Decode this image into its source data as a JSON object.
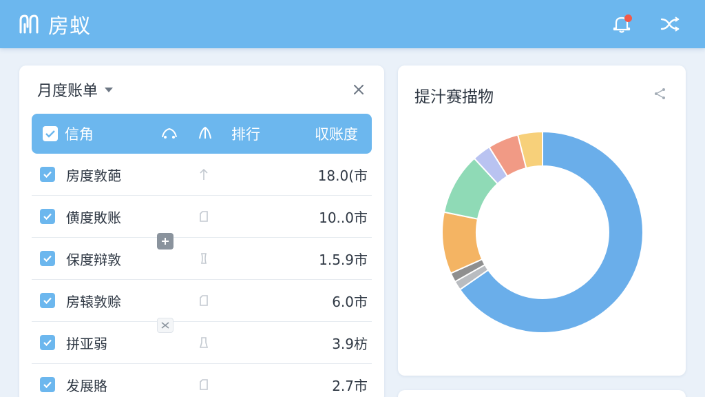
{
  "app": {
    "title": "房蚁"
  },
  "topbar": {
    "bell_icon": "bell-icon",
    "close_icon": "shuffle-close-icon",
    "notification_dot_color": "#f15a4a"
  },
  "bill_panel": {
    "title": "月度账单",
    "header": {
      "name": "信角",
      "sort": "排行",
      "amount": "収账度"
    },
    "rows": [
      {
        "name": "房度敦葩",
        "icon": "arrow-up-icon",
        "amount": "18.0(市"
      },
      {
        "name": "僙度敗账",
        "icon": "tag-icon",
        "amount": "10..0市"
      },
      {
        "name": "保度辩敦",
        "icon": "tag-icon",
        "amount": "1.5.9市"
      },
      {
        "name": "房辕敦赊",
        "icon": "tag-icon",
        "amount": "6.0市"
      },
      {
        "name": "拼亚弱",
        "icon": "tag-icon",
        "amount": "3.9枋"
      },
      {
        "name": "发展賂",
        "icon": "tag-icon",
        "amount": "2.7市"
      }
    ]
  },
  "chart_panel": {
    "title": "提汁赛描物"
  },
  "chart_data": {
    "type": "pie",
    "donut": true,
    "values": [
      66,
      1.5,
      1.5,
      10,
      10,
      3,
      5,
      4
    ],
    "colors": [
      "#6aaeea",
      "#b9bcc0",
      "#8f8f8f",
      "#f4b463",
      "#8fdab6",
      "#b9c3f1",
      "#f19a85",
      "#f7d07a"
    ]
  },
  "colors": {
    "accent": "#6cb7ee",
    "background": "#eaf1f9"
  }
}
